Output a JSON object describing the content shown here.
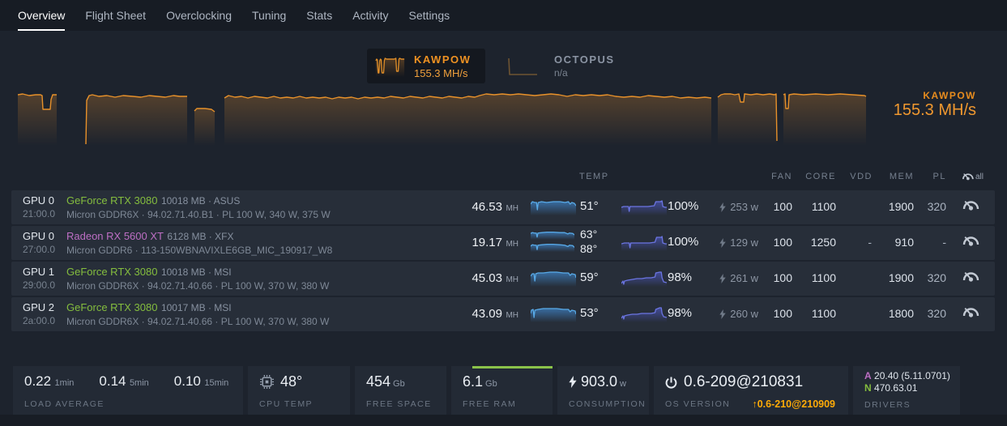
{
  "nav": {
    "tabs": [
      {
        "label": "Overview"
      },
      {
        "label": "Flight Sheet"
      },
      {
        "label": "Overclocking"
      },
      {
        "label": "Tuning"
      },
      {
        "label": "Stats"
      },
      {
        "label": "Activity"
      },
      {
        "label": "Settings"
      }
    ]
  },
  "miners": {
    "kawpow": {
      "name": "KAWPOW",
      "value": "155.3 MH/s"
    },
    "octopus": {
      "name": "OCTOPUS",
      "value": "n/a"
    }
  },
  "hashrate_panel": {
    "algo": "KAWPOW",
    "value": "155.3 MH/s"
  },
  "table": {
    "headers": {
      "temp": "TEMP",
      "fan": "FAN",
      "core": "CORE",
      "vdd": "VDD",
      "mem": "MEM",
      "pl": "PL",
      "all": "all"
    },
    "rows": [
      {
        "gpu": "GPU 0",
        "bus": "21:00.0",
        "name": "GeForce RTX 3080",
        "meminfo": "10018 MB · ASUS",
        "detail": "Micron GDDR6X · 94.02.71.40.B1 · PL 100 W, 340 W, 375 W",
        "hashrate": "46.53",
        "unit": "MH",
        "temps": [
          "51°"
        ],
        "fan_pct": "100%",
        "power": "253",
        "power_unit": "w",
        "fan": "100",
        "core": "1100",
        "vdd": "",
        "mem": "1900",
        "pl": "320"
      },
      {
        "gpu": "GPU 0",
        "bus": "27:00.0",
        "name": "Radeon RX 5600 XT",
        "meminfo": "6128 MB · XFX",
        "detail": "Micron GDDR6 · 113-150WBNAVIXLE6GB_MIC_190917_W8",
        "hashrate": "19.17",
        "unit": "MH",
        "temps": [
          "63°",
          "88°"
        ],
        "fan_pct": "100%",
        "power": "129",
        "power_unit": "w",
        "fan": "100",
        "core": "1250",
        "vdd": "-",
        "mem": "910",
        "pl": "-"
      },
      {
        "gpu": "GPU 1",
        "bus": "29:00.0",
        "name": "GeForce RTX 3080",
        "meminfo": "10018 MB · MSI",
        "detail": "Micron GDDR6X · 94.02.71.40.66 · PL 100 W, 370 W, 380 W",
        "hashrate": "45.03",
        "unit": "MH",
        "temps": [
          "59°"
        ],
        "fan_pct": "98%",
        "power": "261",
        "power_unit": "w",
        "fan": "100",
        "core": "1100",
        "vdd": "",
        "mem": "1900",
        "pl": "320"
      },
      {
        "gpu": "GPU 2",
        "bus": "2a:00.0",
        "name": "GeForce RTX 3080",
        "meminfo": "10017 MB · MSI",
        "detail": "Micron GDDR6X · 94.02.71.40.66 · PL 100 W, 370 W, 380 W",
        "hashrate": "43.09",
        "unit": "MH",
        "temps": [
          "53°"
        ],
        "fan_pct": "98%",
        "power": "260",
        "power_unit": "w",
        "fan": "100",
        "core": "1100",
        "vdd": "",
        "mem": "1800",
        "pl": "320"
      }
    ]
  },
  "footer": {
    "load": {
      "label": "LOAD AVERAGE",
      "items": [
        {
          "value": "0.22",
          "unit": "1min"
        },
        {
          "value": "0.14",
          "unit": "5min"
        },
        {
          "value": "0.10",
          "unit": "15min"
        }
      ]
    },
    "cpu_temp": {
      "value": "48°",
      "label": "CPU TEMP"
    },
    "free_space": {
      "value": "454",
      "unit": "Gb",
      "label": "FREE SPACE"
    },
    "free_ram": {
      "value": "6.1",
      "unit": "Gb",
      "label": "FREE RAM"
    },
    "consumption": {
      "value": "903.0",
      "unit": "w",
      "label": "CONSUMPTION"
    },
    "os": {
      "value": "0.6-209@210831",
      "label": "OS VERSION",
      "upgrade_arrow": "↑",
      "upgrade": "0.6-210@210909"
    },
    "drivers": {
      "label": "DRIVERS",
      "amd_letter": "A",
      "amd_version": "20.40 (5.11.0701)",
      "nvidia_letter": "N",
      "nvidia_version": "470.63.01"
    }
  },
  "colors": {
    "accent_orange": "#e8912a",
    "upgrade_orange": "#ffab07",
    "nvidia_green": "#84bd3e",
    "amd_purple": "#bd6fc4",
    "temp_blue": "#58aae8",
    "fan_indigo": "#6b75e2"
  },
  "charts": {
    "styles": {
      "main": {
        "stroke": "#e8912a",
        "fill": "#c87f2e",
        "fo": 0.32,
        "w": 1.4
      },
      "badge": {
        "stroke": "#dd8c28",
        "fill": "#c87f2e",
        "fo": 0.35,
        "w": 1.4
      },
      "octopus": {
        "stroke": "#6e5432",
        "fill": null,
        "fo": 0,
        "w": 1.6
      },
      "temp": {
        "stroke": "#58aae8",
        "fill": "#3c78b4",
        "fo": 0.85,
        "w": 1.3
      },
      "fan": {
        "stroke": "#6b75e2",
        "fill": "#4a54b4",
        "fo": 0.8,
        "w": 1.3
      }
    },
    "main_segments": [
      "0,13 6,12 14,14 22,13 28,13 30,14 31,31 40,31 41,19 43,13 48,13",
      "84,74 85,20 88,14 92,13 100,15 110,14 120,16 130,14 142,15 152,16 162,14 172,15 182,16 192,14 200,15 209,15",
      "218,33 221,30 231,30 239,31 243,34",
      "255,17 260,14 268,16 276,15 284,17 292,15 300,16 308,17 316,15 324,17 332,16 340,17 348,15 356,17 364,16 372,17 380,16 388,18 396,16 404,17 412,16 420,18 428,16 436,17 444,16 452,17 460,15 468,16 476,17 484,15 492,16 500,17 508,15 516,16 524,17 532,15 540,16 548,17 556,15 564,16 570,14 578,12 588,13 598,12 608,13 618,12 628,13 638,14 648,13 658,12 668,13 678,15 688,13 698,14 708,13 718,14 728,13 738,15 748,16 758,15 768,16 778,14 788,15 798,16 808,15 818,17 828,16 838,17 848,16 856,17",
      "864,16 868,13 872,12 880,12 885,13 890,12 892,22 896,22 897,12 905,13 912,12 920,13 928,12 934,13 936,12 937,70",
      "945,13 947,12 948,30 951,30 952,13 958,12 970,13 985,12 1000,13 1015,12 1030,13 1045,14 1047,15"
    ],
    "badge_kawpow": "1,6 2,4 3,5 4,21 5,21 6,6 7,4 8,5 9,21 11,21 12,6 13,3 15,4 20,4 25,4 27,3 28,19 30,19 31,4 32,3 34,4 38,4",
    "badge_octopus": "2,3 3,23 37,23",
    "temp_sparks": [
      "0,6 2,3 5,4 7,4 8,13 9,4 13,3 19,4 27,3 35,3 41,4 45,3 47,6 49,4 52,5 54,8",
      "0,6 2,4 5,5 7,5 8,14 9,5 14,4 20,3 28,3 36,4 42,4 46,7 48,5 52,6 54,9",
      "0,7 2,4 5,5 7,5 8,15 9,5 14,4 20,3 28,3 36,4 42,5 46,8 48,5 52,6 54,10",
      "0,7 2,4 4,4 5,13 6,4 9,3 15,3 23,2 31,2 39,3 45,3 47,6 49,4 53,5 54,9",
      "0,9 1,5 3,4 4,14 5,5 9,4 15,3 23,3 31,3 39,4 45,4 47,7 49,5 53,6 54,10"
    ],
    "fan_sparks": [
      "0,10 3,9 9,9 10,15 11,9 22,9 34,9 42,8 44,3 50,3 52,2 53,9 56,10 58,10",
      "0,11 4,10 10,10 11,16 12,10 24,10 36,10 43,9 45,3 51,3 52,2 53,10 56,11 58,11",
      "0,16 2,13 3,17 4,13 8,12 14,11 20,10 26,10 32,9 38,9 43,8 44,3 49,2 51,2 52,9 54,14 58,15",
      "0,15 2,12 3,16 4,12 8,11 14,10 20,10 26,9 32,9 38,9 43,8 44,4 49,2 51,2 52,9 54,13 58,14"
    ]
  }
}
